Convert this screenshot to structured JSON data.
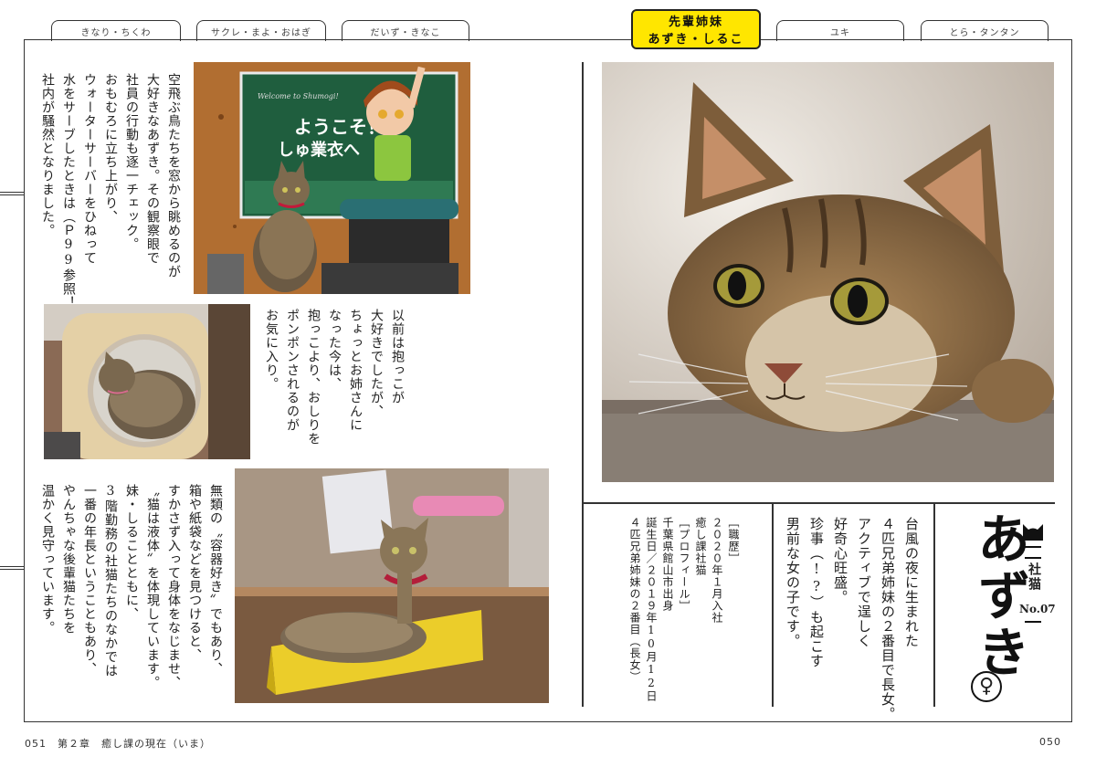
{
  "tabs": [
    {
      "label": "きなり・ちくわ"
    },
    {
      "label": "サクレ・まよ・おはぎ"
    },
    {
      "label": "だいず・きなこ"
    },
    {
      "label_top": "先輩姉妹",
      "label_bottom": "あずき・しるこ"
    },
    {
      "label": "ユキ"
    },
    {
      "label": "とら・タンタン"
    }
  ],
  "text1": "空飛ぶ鳥たちを窓から眺めるのが\n大好きなあずき。その観察眼で\n社員の行動も逐一チェック。\nおもむろに立ち上がり、\nウォーターサーバーをひねって\n水をサーブしたときは（Ｐ99参照！）\n社内が騒然となりました。",
  "sign": {
    "line1": "ようこそ！",
    "line2": "しゅ業衣へ",
    "small": "Welcome to Shumogi!"
  },
  "text2": "以前は抱っこが\n大好きでしたが、\nちょっとお姉さんに\nなった今は、\n抱っこより、おしりを\nポンポンされるのが\nお気に入り。",
  "text3": "無類の〝容器好き〟でもあり、\n箱や紙袋などを見つけると、\nすかさず入って身体をなじませ、\n〝猫は液体〟を体現しています。\n妹・しることともに、\n3階勤務の社猫たちのなかでは\n一番の年長ということもあり、\nやんちゃな後輩猫たちを\n温かく見守っています。",
  "profile": {
    "career_label": "［職歴］",
    "career_1": "２０２０年１月入社",
    "career_2": "癒し課社猫",
    "profile_label": "［プロフィール］",
    "birthplace": "千葉県館山市出身",
    "birthday": "誕生日／２０１９年10月12日",
    "family": "４匹兄弟姉妹の２番目（長女）"
  },
  "intro": "台風の夜に生まれた\n４匹兄弟姉妹の２番目で長女。\nアクティブで逞しく\n好奇心旺盛。\n珍事（!?）も起こす\n男前な女の子です。",
  "name": "あずき",
  "label": "社猫",
  "number": "No.07",
  "gender": "♀",
  "footer_left": "051　第２章　癒し課の現在（いま）",
  "footer_right": "050",
  "colors": {
    "accent": "#ffe600",
    "line": "#333333"
  }
}
